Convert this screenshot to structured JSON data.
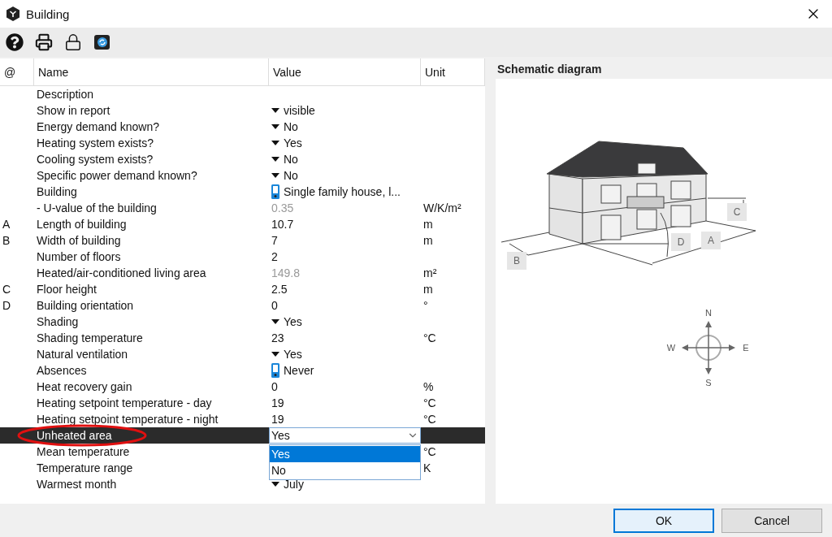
{
  "window": {
    "title": "Building"
  },
  "table": {
    "columns": [
      "@",
      "Name",
      "Value",
      "Unit"
    ],
    "rows": [
      {
        "marker": "",
        "name": "Description",
        "kind": "text",
        "value": "",
        "unit": "",
        "selected": false
      },
      {
        "marker": "",
        "name": "Show in report",
        "kind": "dropdown",
        "value": "visible",
        "unit": "",
        "selected": false
      },
      {
        "marker": "",
        "name": "Energy demand known?",
        "kind": "dropdown",
        "value": "No",
        "unit": "",
        "selected": false
      },
      {
        "marker": "",
        "name": "Heating system exists?",
        "kind": "dropdown",
        "value": "Yes",
        "unit": "",
        "selected": false
      },
      {
        "marker": "",
        "name": "Cooling system exists?",
        "kind": "dropdown",
        "value": "No",
        "unit": "",
        "selected": false
      },
      {
        "marker": "",
        "name": "Specific power demand known?",
        "kind": "dropdown",
        "value": "No",
        "unit": "",
        "selected": false
      },
      {
        "marker": "",
        "name": "Building",
        "kind": "link",
        "value": "Single family house, l...",
        "unit": "",
        "selected": false
      },
      {
        "marker": "",
        "name": "- U-value of the building",
        "kind": "derived",
        "value": "0.35",
        "unit": "W/K/m²",
        "selected": false
      },
      {
        "marker": "A",
        "name": "Length of building",
        "kind": "text",
        "value": "10.7",
        "unit": "m",
        "selected": false
      },
      {
        "marker": "B",
        "name": "Width of building",
        "kind": "text",
        "value": "7",
        "unit": "m",
        "selected": false
      },
      {
        "marker": "",
        "name": "Number of floors",
        "kind": "text",
        "value": "2",
        "unit": "",
        "selected": false
      },
      {
        "marker": "",
        "name": "Heated/air-conditioned living area",
        "kind": "derived",
        "value": "149.8",
        "unit": "m²",
        "selected": false
      },
      {
        "marker": "C",
        "name": "Floor height",
        "kind": "text",
        "value": "2.5",
        "unit": "m",
        "selected": false
      },
      {
        "marker": "D",
        "name": "Building orientation",
        "kind": "text",
        "value": "0",
        "unit": "°",
        "selected": false
      },
      {
        "marker": "",
        "name": "Shading",
        "kind": "dropdown",
        "value": "Yes",
        "unit": "",
        "selected": false
      },
      {
        "marker": "",
        "name": "Shading temperature",
        "kind": "text",
        "value": "23",
        "unit": "°C",
        "selected": false
      },
      {
        "marker": "",
        "name": "Natural ventilation",
        "kind": "dropdown",
        "value": "Yes",
        "unit": "",
        "selected": false
      },
      {
        "marker": "",
        "name": "Absences",
        "kind": "link",
        "value": "Never",
        "unit": "",
        "selected": false
      },
      {
        "marker": "",
        "name": "Heat recovery gain",
        "kind": "text",
        "value": "0",
        "unit": "%",
        "selected": false
      },
      {
        "marker": "",
        "name": "Heating setpoint temperature - day",
        "kind": "text",
        "value": "19",
        "unit": "°C",
        "selected": false
      },
      {
        "marker": "",
        "name": "Heating setpoint temperature - night",
        "kind": "text",
        "value": "19",
        "unit": "°C",
        "selected": false
      },
      {
        "marker": "",
        "name": "Unheated area",
        "kind": "combo",
        "value": "Yes",
        "unit": "",
        "selected": true,
        "options": [
          {
            "label": "Yes",
            "selected": true
          },
          {
            "label": "No",
            "selected": false
          }
        ]
      },
      {
        "marker": "",
        "name": "Mean temperature",
        "kind": "text",
        "value": "",
        "unit": "°C",
        "selected": false
      },
      {
        "marker": "",
        "name": "Temperature range",
        "kind": "text",
        "value": "",
        "unit": "K",
        "selected": false
      },
      {
        "marker": "",
        "name": "Warmest month",
        "kind": "dropdown",
        "value": "July",
        "unit": "",
        "selected": false
      }
    ]
  },
  "diagram": {
    "title": "Schematic diagram",
    "dimension_labels": [
      "A",
      "B",
      "C",
      "D"
    ],
    "compass": {
      "north": "N",
      "east": "E",
      "south": "S",
      "west": "W"
    }
  },
  "buttons": [
    "OK",
    "Cancel"
  ]
}
